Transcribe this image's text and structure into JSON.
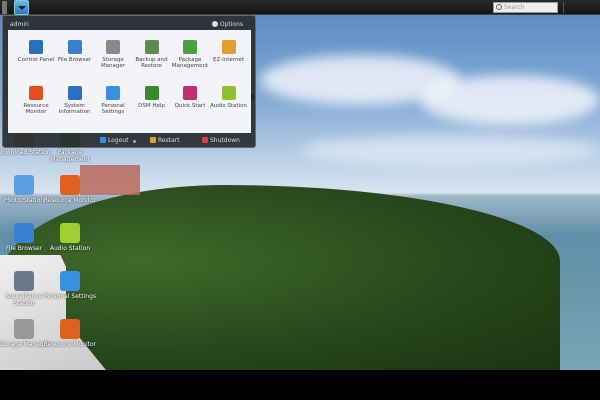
{
  "taskbar": {
    "search_placeholder": "Search"
  },
  "menu": {
    "user": "admin",
    "options": "Options",
    "apps": [
      {
        "label": "Control Panel",
        "icon": "control-panel-icon",
        "color": "#2a6fc0"
      },
      {
        "label": "File Browser",
        "icon": "file-browser-icon",
        "color": "#3b7fd0"
      },
      {
        "label": "Storage Manager",
        "icon": "storage-manager-icon",
        "color": "#888888"
      },
      {
        "label": "Backup and Restore",
        "icon": "backup-restore-icon",
        "color": "#5a8a50"
      },
      {
        "label": "Package Management",
        "icon": "package-icon",
        "color": "#4aa040"
      },
      {
        "label": "EZ-Internet",
        "icon": "ez-internet-icon",
        "color": "#e0a030"
      },
      {
        "label": "Resource Monitor",
        "icon": "resource-monitor-icon",
        "color": "#e05020"
      },
      {
        "label": "System Information",
        "icon": "info-icon",
        "color": "#2a70c8"
      },
      {
        "label": "Personal Settings",
        "icon": "personal-settings-icon",
        "color": "#3a90e0"
      },
      {
        "label": "DSM Help",
        "icon": "help-icon",
        "color": "#3a8a30"
      },
      {
        "label": "Quick Start",
        "icon": "quick-start-icon",
        "color": "#c03070"
      },
      {
        "label": "Audio Station",
        "icon": "audio-station-icon",
        "color": "#90c030"
      }
    ],
    "logout": "Logout",
    "restart": "Restart",
    "shutdown": "Shutdown"
  },
  "desktop": [
    {
      "label": "Download Station",
      "icon": "download-station-icon",
      "color": "#c08030"
    },
    {
      "label": "Package Management",
      "icon": "package-icon",
      "color": "#4a8a30"
    },
    {
      "label": "Photo Station",
      "icon": "photo-station-icon",
      "color": "#5aa0e0"
    },
    {
      "label": "Resource Monitor",
      "icon": "resource-monitor-icon",
      "color": "#e06020"
    },
    {
      "label": "File Browser",
      "icon": "file-browser-icon",
      "color": "#3b7fd0"
    },
    {
      "label": "Audio Station",
      "icon": "audio-station-icon",
      "color": "#a0d030"
    },
    {
      "label": "Surveillance Station",
      "icon": "surveillance-icon",
      "color": "#6a7a8a"
    },
    {
      "label": "Personal Settings",
      "icon": "personal-settings-icon",
      "color": "#3a90e0"
    },
    {
      "label": "Storage Manager",
      "icon": "storage-manager-icon",
      "color": "#999999"
    },
    {
      "label": "Resource Monitor",
      "icon": "resource-monitor-icon",
      "color": "#e06020"
    }
  ]
}
